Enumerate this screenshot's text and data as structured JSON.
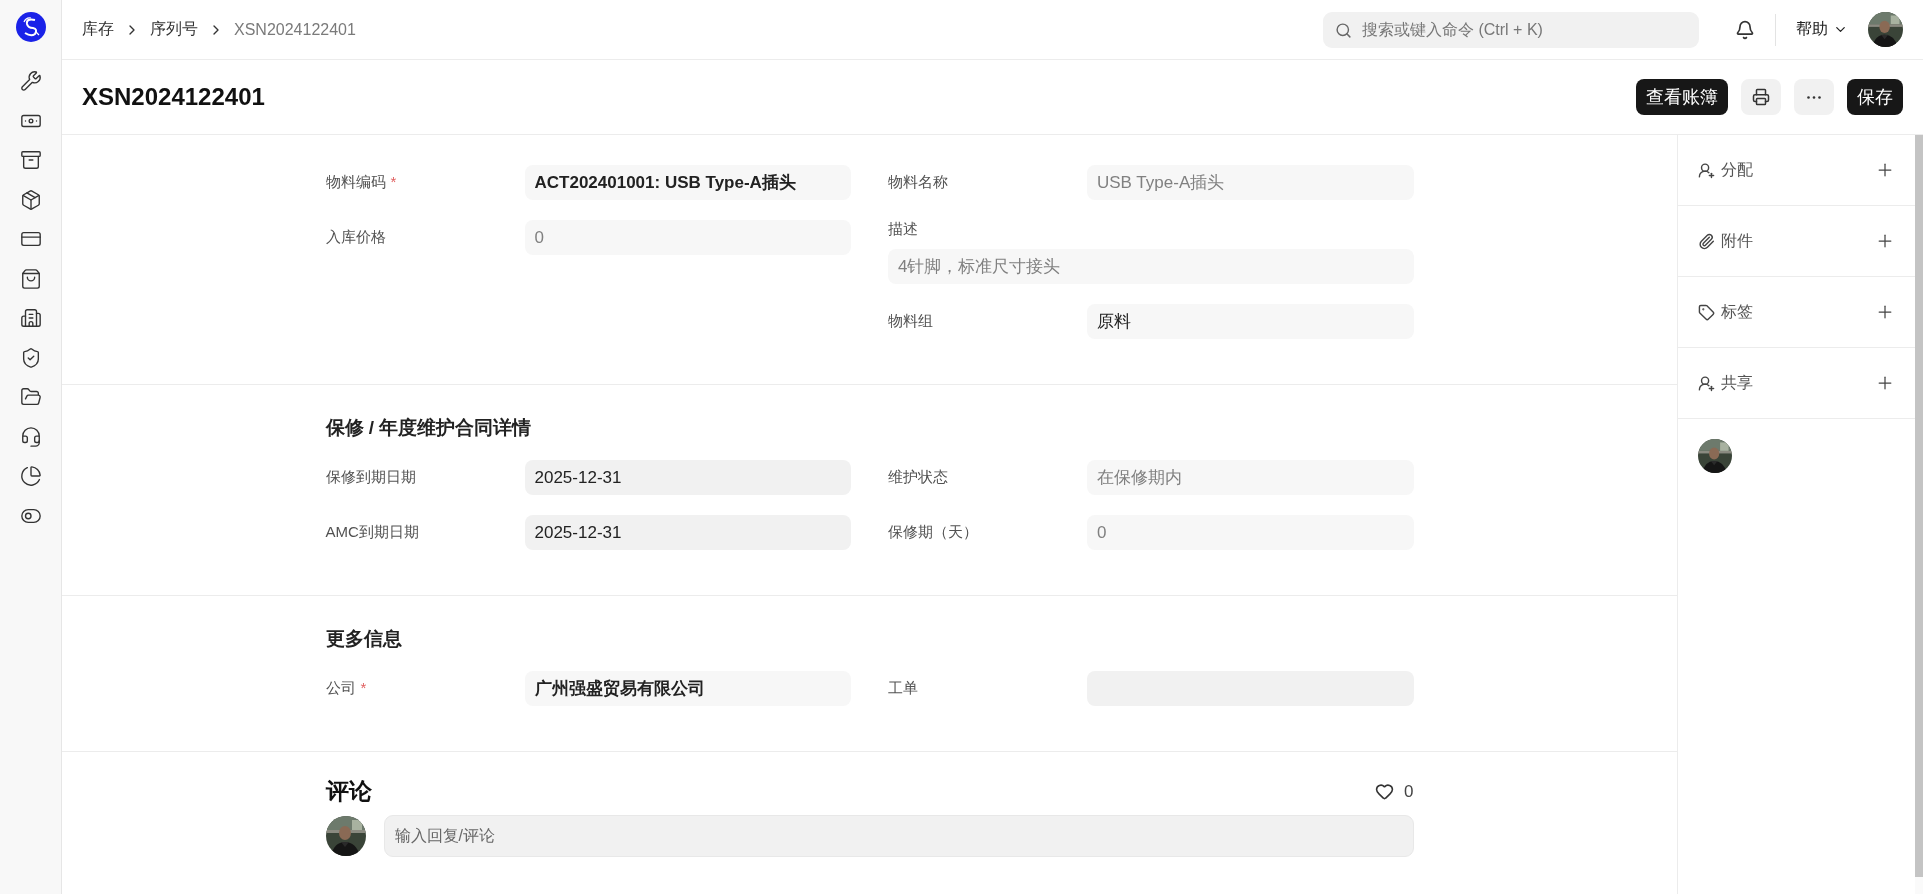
{
  "breadcrumbs": [
    {
      "label": "库存",
      "current": false
    },
    {
      "label": "序列号",
      "current": false
    },
    {
      "label": "XSN2024122401",
      "current": true
    }
  ],
  "search": {
    "placeholder": "搜索或键入命令 (Ctrl + K)"
  },
  "help_menu": {
    "label": "帮助"
  },
  "title": "XSN2024122401",
  "actions": [
    {
      "kind": "primary",
      "label": "查看账簿"
    },
    {
      "kind": "print"
    },
    {
      "kind": "more"
    },
    {
      "kind": "primary",
      "label": "保存"
    }
  ],
  "sections": [
    {
      "columns": [
        [
          {
            "label": "物料编码",
            "required_mark": "*",
            "value": "ACT202401001: USB Type-A插头",
            "kind": "link",
            "readonly": false
          },
          {
            "label": "入库价格",
            "value": "0",
            "kind": "data",
            "readonly": true
          }
        ],
        [
          {
            "label": "物料名称",
            "value": "USB Type-A插头",
            "kind": "data",
            "readonly": true
          },
          {
            "label": "描述",
            "value": "4针脚，标准尺寸接头",
            "kind": "textarea",
            "readonly": true
          },
          {
            "label": "物料组",
            "value": "原料",
            "kind": "data",
            "readonly": false
          }
        ]
      ]
    },
    {
      "heading": "保修 / 年度维护合同详情",
      "columns": [
        [
          {
            "label": "保修到期日期",
            "value": "2025-12-31",
            "kind": "date",
            "readonly": false
          },
          {
            "label": "AMC到期日期",
            "value": "2025-12-31",
            "kind": "date",
            "readonly": false
          }
        ],
        [
          {
            "label": "维护状态",
            "value": "在保修期内",
            "kind": "data",
            "readonly": true
          },
          {
            "label": "保修期（天）",
            "value": "0",
            "kind": "data",
            "readonly": true
          }
        ]
      ]
    },
    {
      "heading": "更多信息",
      "columns": [
        [
          {
            "label": "公司",
            "required_mark": "*",
            "value": "广州强盛贸易有限公司",
            "kind": "link",
            "readonly": false
          }
        ],
        [
          {
            "label": "工单",
            "kind": "date"
          }
        ]
      ]
    }
  ],
  "comments": {
    "heading": "评论",
    "likes": "0",
    "placeholder": "输入回复/评论"
  },
  "side_actions": [
    {
      "kind": "assign",
      "label": "分配"
    },
    {
      "kind": "attachment",
      "label": "附件"
    },
    {
      "kind": "tag",
      "label": "标签"
    },
    {
      "kind": "share",
      "label": "共享"
    }
  ]
}
